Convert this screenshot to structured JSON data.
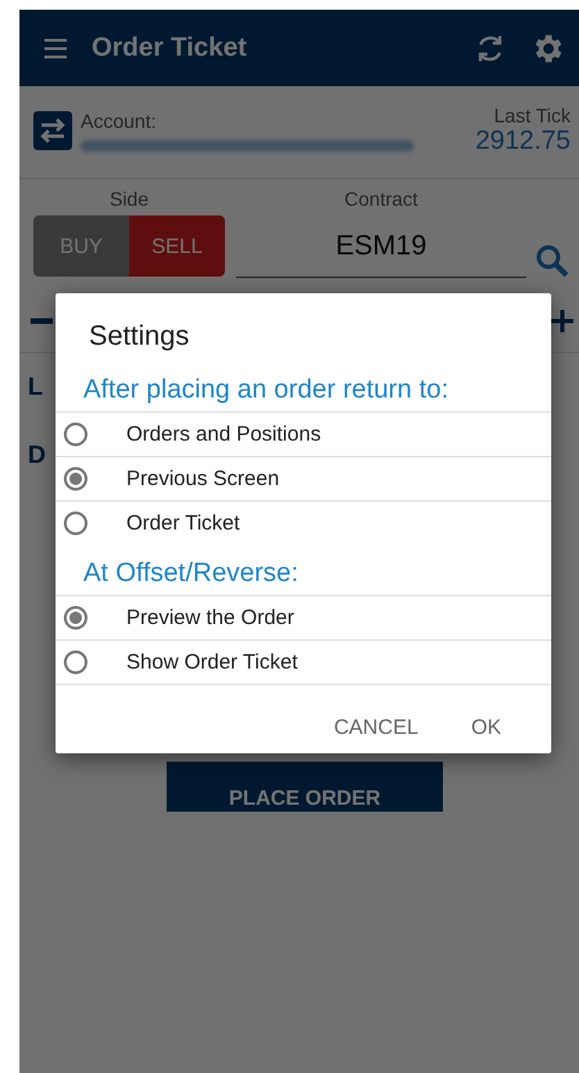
{
  "app_bar": {
    "title": "Order Ticket"
  },
  "account": {
    "label": "Account:"
  },
  "last_tick": {
    "label": "Last Tick",
    "value": "2912.75"
  },
  "side": {
    "label": "Side",
    "options": [
      {
        "label": "BUY",
        "selected": false
      },
      {
        "label": "SELL",
        "selected": true
      }
    ]
  },
  "contract": {
    "label": "Contract",
    "value": "ESM19"
  },
  "field_labels": [
    "L",
    "D"
  ],
  "place_order": {
    "label": "PLACE ORDER"
  },
  "dialog": {
    "title": "Settings",
    "sections": [
      {
        "heading": "After placing an order return to:",
        "options": [
          {
            "label": "Orders and Positions",
            "selected": false
          },
          {
            "label": "Previous Screen",
            "selected": true
          },
          {
            "label": "Order Ticket",
            "selected": false
          }
        ]
      },
      {
        "heading": "At Offset/Reverse:",
        "options": [
          {
            "label": "Preview the Order",
            "selected": true
          },
          {
            "label": "Show Order Ticket",
            "selected": false
          }
        ]
      }
    ],
    "buttons": [
      "CANCEL",
      "OK"
    ]
  }
}
